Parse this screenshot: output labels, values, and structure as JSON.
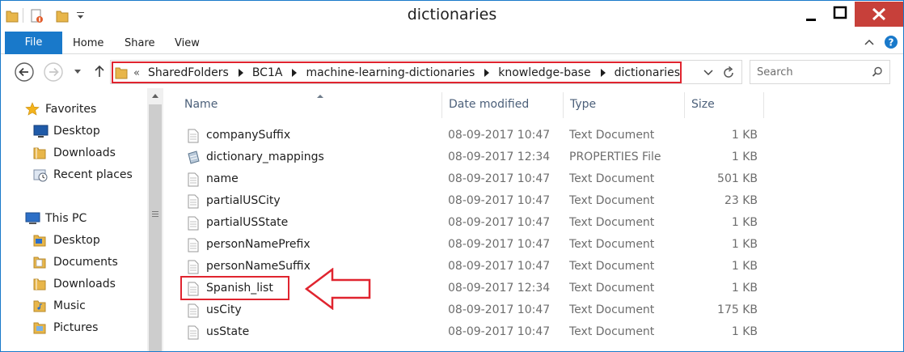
{
  "window": {
    "title": "dictionaries"
  },
  "ribbon": {
    "file": "File",
    "home": "Home",
    "share": "Share",
    "view": "View"
  },
  "address": {
    "overflow": "«",
    "crumbs": [
      "SharedFolders",
      "BC1A",
      "machine-learning-dictionaries",
      "knowledge-base",
      "dictionaries"
    ]
  },
  "search": {
    "placeholder": "Search"
  },
  "nav": {
    "favorites": "Favorites",
    "fav_items": [
      "Desktop",
      "Downloads",
      "Recent places"
    ],
    "thispc": "This PC",
    "pc_items": [
      "Desktop",
      "Documents",
      "Downloads",
      "Music",
      "Pictures"
    ]
  },
  "columns": {
    "name": "Name",
    "date": "Date modified",
    "type": "Type",
    "size": "Size"
  },
  "files": [
    {
      "name": "companySuffix",
      "date": "08-09-2017 10:47",
      "type": "Text Document",
      "size": "1 KB",
      "icon": "text-file-icon"
    },
    {
      "name": "dictionary_mappings",
      "date": "08-09-2017 12:34",
      "type": "PROPERTIES File",
      "size": "1 KB",
      "icon": "properties-file-icon"
    },
    {
      "name": "name",
      "date": "08-09-2017 10:47",
      "type": "Text Document",
      "size": "501 KB",
      "icon": "text-file-icon"
    },
    {
      "name": "partialUSCity",
      "date": "08-09-2017 10:47",
      "type": "Text Document",
      "size": "23 KB",
      "icon": "text-file-icon"
    },
    {
      "name": "partialUSState",
      "date": "08-09-2017 10:47",
      "type": "Text Document",
      "size": "1 KB",
      "icon": "text-file-icon"
    },
    {
      "name": "personNamePrefix",
      "date": "08-09-2017 10:47",
      "type": "Text Document",
      "size": "1 KB",
      "icon": "text-file-icon"
    },
    {
      "name": "personNameSuffix",
      "date": "08-09-2017 10:47",
      "type": "Text Document",
      "size": "1 KB",
      "icon": "text-file-icon"
    },
    {
      "name": "Spanish_list",
      "date": "08-09-2017 12:34",
      "type": "Text Document",
      "size": "1 KB",
      "icon": "text-file-icon"
    },
    {
      "name": "usCity",
      "date": "08-09-2017 10:47",
      "type": "Text Document",
      "size": "175 KB",
      "icon": "text-file-icon"
    },
    {
      "name": "usState",
      "date": "08-09-2017 10:47",
      "type": "Text Document",
      "size": "1 KB",
      "icon": "text-file-icon"
    }
  ],
  "colors": {
    "accent": "#1979ca",
    "highlight": "#e0242f",
    "folder": "#e8b64a"
  }
}
